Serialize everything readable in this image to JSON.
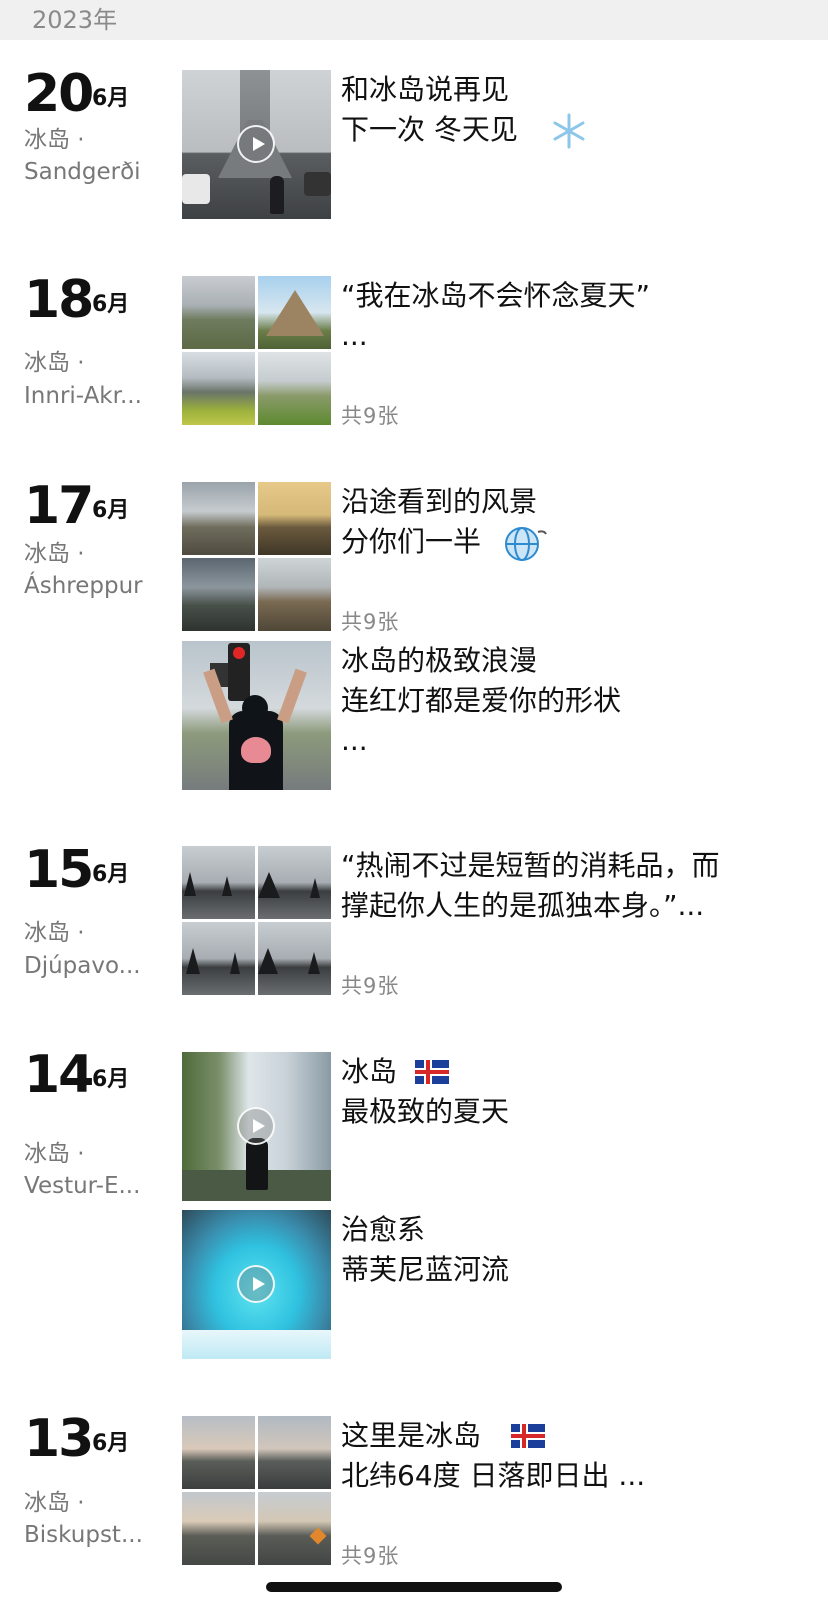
{
  "year_header": "2023年",
  "entries": [
    {
      "day": "20",
      "month": "6月",
      "place": "冰岛 ·",
      "sub": "Sandgerði",
      "posts": [
        {
          "caption": "和冰岛说再见\n下一次 冬天见"
        }
      ]
    },
    {
      "day": "18",
      "month": "6月",
      "place": "冰岛 ·",
      "sub": "Innri-Akr...",
      "posts": [
        {
          "caption": "“我在冰岛不会怀念夏天”\n...",
          "count": "共9张"
        }
      ]
    },
    {
      "day": "17",
      "month": "6月",
      "place": "冰岛 ·",
      "sub": "Áshreppur",
      "posts": [
        {
          "caption": "沿途看到的风景\n分你们一半",
          "count": "共9张"
        },
        {
          "caption": "冰岛的极致浪漫\n连红灯都是爱你的形状\n..."
        }
      ]
    },
    {
      "day": "15",
      "month": "6月",
      "place": "冰岛 ·",
      "sub": "Djúpavo...",
      "posts": [
        {
          "caption": "“热闹不过是短暂的消耗品，而\n撑起你人生的是孤独本身。”...",
          "count": "共9张"
        }
      ]
    },
    {
      "day": "14",
      "month": "6月",
      "place": "冰岛 ·",
      "sub": "Vestur-E...",
      "posts": [
        {
          "caption": "冰岛\n最极致的夏天"
        },
        {
          "caption": "治愈系\n蒂芙尼蓝河流"
        }
      ]
    },
    {
      "day": "13",
      "month": "6月",
      "place": "冰岛 ·",
      "sub": "Biskupst...",
      "posts": [
        {
          "caption": "这里是冰岛\n北纬64度 日落即日出 ...",
          "count": "共9张"
        }
      ]
    }
  ],
  "icons": {
    "play": "play-icon",
    "snowflake": "snowflake-icon",
    "globe": "globe-icon",
    "flag": "iceland-flag-icon"
  },
  "colors": {
    "header_bg": "#f0f0f0",
    "secondary_text": "#888888",
    "home_indicator": "#111111"
  }
}
